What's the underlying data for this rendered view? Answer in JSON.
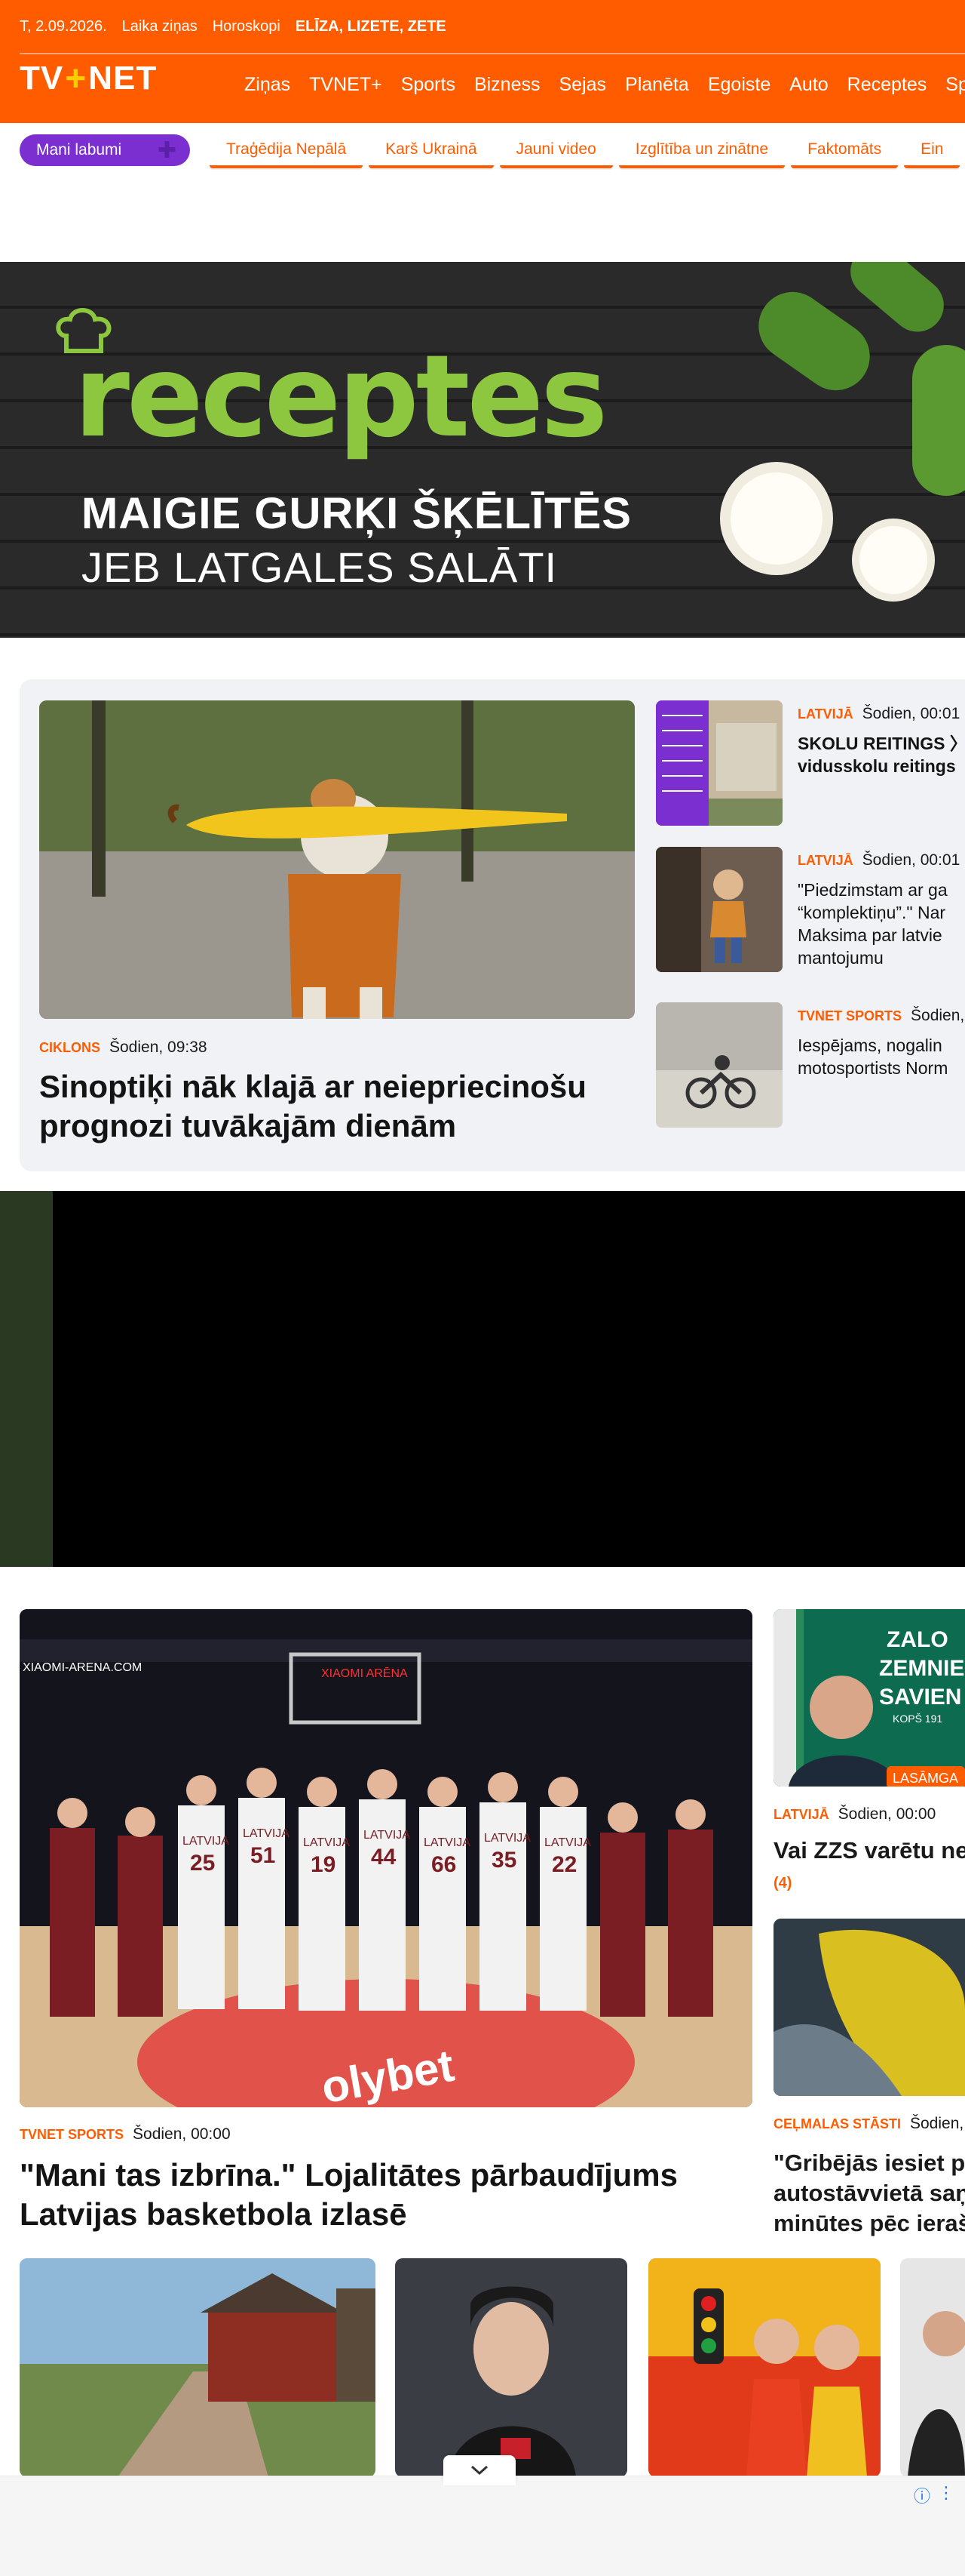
{
  "topbar": {
    "date": "T, 2.09.2026.",
    "weather": "Laika ziņas",
    "horoscope": "Horoskopi",
    "namedays": "ELĪZA, LIZETE, ZETE"
  },
  "logo": {
    "left": "TV",
    "plus": "+",
    "right": "NET"
  },
  "nav": [
    "Ziņas",
    "TVNET+",
    "Sports",
    "Bizness",
    "Sejas",
    "Planēta",
    "Egoiste",
    "Auto",
    "Receptes",
    "Spo"
  ],
  "subnav": {
    "favorites": "Mani labumi",
    "chips": [
      "Traģēdija Nepālā",
      "Karš Ukrainā",
      "Jauni video",
      "Izglītība un zinātne",
      "Faktomāts",
      "Ein"
    ]
  },
  "banner": {
    "brand": "receptes",
    "line1": "MAIGIE GURĶI ŠĶĒLĪTĒS",
    "line2": "JEB LATGALES SALĀTI"
  },
  "featured": {
    "category": "CIKLONS",
    "time": "Šodien, 09:38",
    "title": "Sinoptiķi nāk klajā ar neiepriecinošu prognozi tuvākajām dienām"
  },
  "side_news": [
    {
      "category": "LATVIJĀ",
      "time": "Šodien, 00:01",
      "title_line1": "SKOLU REITINGS 〉",
      "title_line2": "vidusskolu reitings"
    },
    {
      "category": "LATVIJĀ",
      "time": "Šodien, 00:01",
      "title_line1": "\"Piedzimstam ar ga",
      "title_line2": "“komplektiņu”.\" Nar",
      "title_line3": "Maksima par latvie",
      "title_line4": "mantojumu"
    },
    {
      "category": "TVNET SPORTS",
      "time": "Šodien,",
      "title_line1": "Iespējams, nogalin",
      "title_line2": "motosportists Norm"
    }
  ],
  "second_main": {
    "category": "TVNET SPORTS",
    "time": "Šodien, 00:00",
    "title": "\"Mani tas izbrīna.\" Lojalitātes pārbaudījums Latvijas basketbola izlasē",
    "arena_label": "XIAOMI-ARENA.COM",
    "scoreboard_label": "XIAOMI ARĒNA",
    "court_logo": "olybet",
    "jersey_text": "LATVIJA",
    "jersey_numbers": [
      "25",
      "51",
      "19",
      "44",
      "66",
      "35",
      "22"
    ]
  },
  "right_news": [
    {
      "category": "LATVIJĀ",
      "time": "Šodien, 00:00",
      "title": "Vai ZZS varētu ne",
      "count": "(4)",
      "badge": "LASĀMGA",
      "img_text": "ZALO ZEMNIE SAVIEN KOPŠ 191"
    },
    {
      "category": "CEĻMALAS STĀSTI",
      "time": "Šodien,",
      "title_line1": "\"Gribējās iesiet pa",
      "title_line2": "autostāvvietā saņ",
      "title_line3": "minūtes pēc ierašā"
    }
  ],
  "ad": {
    "collapse_icon": "chevron-down-icon",
    "info": "ⓘ",
    "menu": "⋮"
  },
  "colors": {
    "brand": "#ff5c00",
    "purple": "#7b2fd0",
    "green": "#8dc63f"
  }
}
